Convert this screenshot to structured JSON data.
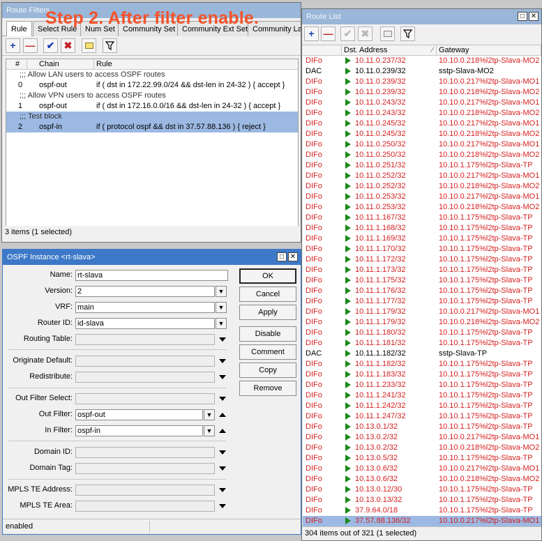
{
  "overlay_text": "Step 2. After filter enable.",
  "route_filters": {
    "title": "Route Filters",
    "tabs": [
      "Rule",
      "Select Rule",
      "Num Set",
      "Community Set",
      "Community Ext Set",
      "Community Lar"
    ],
    "columns": [
      "#",
      "Chain",
      "Rule"
    ],
    "rows": [
      {
        "type": "comment",
        "text": ";;; Allow LAN users to access OSPF routes"
      },
      {
        "type": "rule",
        "num": "0",
        "chain": "ospf-out",
        "rule": "if ( dst in 172.22.99.0/24 && dst-len in 24-32 ) { accept }"
      },
      {
        "type": "comment",
        "text": ";;; Allow VPN users to access OSPF routes"
      },
      {
        "type": "rule",
        "num": "1",
        "chain": "ospf-out",
        "rule": "if ( dst in 172.16.0.0/16 && dst-len in 24-32 ) { accept }"
      },
      {
        "type": "comment",
        "text": ";;; Test block",
        "selected": true
      },
      {
        "type": "rule",
        "num": "2",
        "chain": "ospf-in",
        "rule": "if ( protocol ospf && dst in 37.57.88.136 ) { reject }",
        "selected": true
      }
    ],
    "status": "3 items (1 selected)"
  },
  "ospf_instance": {
    "title": "OSPF Instance <rt-slava>",
    "fields": {
      "name_label": "Name:",
      "name": "rt-slava",
      "version_label": "Version:",
      "version": "2",
      "vrf_label": "VRF:",
      "vrf": "main",
      "router_id_label": "Router ID:",
      "router_id": "id-slava",
      "routing_table_label": "Routing Table:",
      "originate_default_label": "Originate Default:",
      "redistribute_label": "Redistribute:",
      "out_filter_select_label": "Out Filter Select:",
      "out_filter_label": "Out Filter:",
      "out_filter": "ospf-out",
      "in_filter_label": "In Filter:",
      "in_filter": "ospf-in",
      "domain_id_label": "Domain ID:",
      "domain_tag_label": "Domain Tag:",
      "mpls_te_address_label": "MPLS TE Address:",
      "mpls_te_area_label": "MPLS TE Area:"
    },
    "buttons": {
      "ok": "OK",
      "cancel": "Cancel",
      "apply": "Apply",
      "disable": "Disable",
      "comment": "Comment",
      "copy": "Copy",
      "remove": "Remove"
    },
    "status": "enabled"
  },
  "route_list": {
    "title": "Route List",
    "columns": [
      "Dst. Address",
      "Gateway"
    ],
    "rows": [
      {
        "flags": "DIFo",
        "dst": "10.11.0.237/32",
        "gw": "10.10.0.218%l2tp-Slava-MO2",
        "red": true
      },
      {
        "flags": "DAC",
        "dst": "10.11.0.239/32",
        "gw": "sstp-Slava-MO2",
        "red": false
      },
      {
        "flags": "DIFo",
        "dst": "10.11.0.239/32",
        "gw": "10.10.0.217%l2tp-Slava-MO1",
        "red": true
      },
      {
        "flags": "DIFo",
        "dst": "10.11.0.239/32",
        "gw": "10.10.0.218%l2tp-Slava-MO2",
        "red": true
      },
      {
        "flags": "DIFo",
        "dst": "10.11.0.243/32",
        "gw": "10.10.0.217%l2tp-Slava-MO1",
        "red": true
      },
      {
        "flags": "DIFo",
        "dst": "10.11.0.243/32",
        "gw": "10.10.0.218%l2tp-Slava-MO2",
        "red": true
      },
      {
        "flags": "DIFo",
        "dst": "10.11.0.245/32",
        "gw": "10.10.0.217%l2tp-Slava-MO1",
        "red": true
      },
      {
        "flags": "DIFo",
        "dst": "10.11.0.245/32",
        "gw": "10.10.0.218%l2tp-Slava-MO2",
        "red": true
      },
      {
        "flags": "DIFo",
        "dst": "10.11.0.250/32",
        "gw": "10.10.0.217%l2tp-Slava-MO1",
        "red": true
      },
      {
        "flags": "DIFo",
        "dst": "10.11.0.250/32",
        "gw": "10.10.0.218%l2tp-Slava-MO2",
        "red": true
      },
      {
        "flags": "DIFo",
        "dst": "10.11.0.251/32",
        "gw": "10.10.1.175%l2tp-Slava-TP",
        "red": true
      },
      {
        "flags": "DIFo",
        "dst": "10.11.0.252/32",
        "gw": "10.10.0.217%l2tp-Slava-MO1",
        "red": true
      },
      {
        "flags": "DIFo",
        "dst": "10.11.0.252/32",
        "gw": "10.10.0.218%l2tp-Slava-MO2",
        "red": true
      },
      {
        "flags": "DIFo",
        "dst": "10.11.0.253/32",
        "gw": "10.10.0.217%l2tp-Slava-MO1",
        "red": true
      },
      {
        "flags": "DIFo",
        "dst": "10.11.0.253/32",
        "gw": "10.10.0.218%l2tp-Slava-MO2",
        "red": true
      },
      {
        "flags": "DIFo",
        "dst": "10.11.1.167/32",
        "gw": "10.10.1.175%l2tp-Slava-TP",
        "red": true
      },
      {
        "flags": "DIFo",
        "dst": "10.11.1.168/32",
        "gw": "10.10.1.175%l2tp-Slava-TP",
        "red": true
      },
      {
        "flags": "DIFo",
        "dst": "10.11.1.169/32",
        "gw": "10.10.1.175%l2tp-Slava-TP",
        "red": true
      },
      {
        "flags": "DIFo",
        "dst": "10.11.1.170/32",
        "gw": "10.10.1.175%l2tp-Slava-TP",
        "red": true
      },
      {
        "flags": "DIFo",
        "dst": "10.11.1.172/32",
        "gw": "10.10.1.175%l2tp-Slava-TP",
        "red": true
      },
      {
        "flags": "DIFo",
        "dst": "10.11.1.173/32",
        "gw": "10.10.1.175%l2tp-Slava-TP",
        "red": true
      },
      {
        "flags": "DIFo",
        "dst": "10.11.1.175/32",
        "gw": "10.10.1.175%l2tp-Slava-TP",
        "red": true
      },
      {
        "flags": "DIFo",
        "dst": "10.11.1.176/32",
        "gw": "10.10.1.175%l2tp-Slava-TP",
        "red": true
      },
      {
        "flags": "DIFo",
        "dst": "10.11.1.177/32",
        "gw": "10.10.1.175%l2tp-Slava-TP",
        "red": true
      },
      {
        "flags": "DIFo",
        "dst": "10.11.1.179/32",
        "gw": "10.10.0.217%l2tp-Slava-MO1",
        "red": true
      },
      {
        "flags": "DIFo",
        "dst": "10.11.1.179/32",
        "gw": "10.10.0.218%l2tp-Slava-MO2",
        "red": true
      },
      {
        "flags": "DIFo",
        "dst": "10.11.1.180/32",
        "gw": "10.10.1.175%l2tp-Slava-TP",
        "red": true
      },
      {
        "flags": "DIFo",
        "dst": "10.11.1.181/32",
        "gw": "10.10.1.175%l2tp-Slava-TP",
        "red": true
      },
      {
        "flags": "DAC",
        "dst": "10.11.1.182/32",
        "gw": "sstp-Slava-TP",
        "red": false
      },
      {
        "flags": "DIFo",
        "dst": "10.11.1.182/32",
        "gw": "10.10.1.175%l2tp-Slava-TP",
        "red": true
      },
      {
        "flags": "DIFo",
        "dst": "10.11.1.183/32",
        "gw": "10.10.1.175%l2tp-Slava-TP",
        "red": true
      },
      {
        "flags": "DIFo",
        "dst": "10.11.1.233/32",
        "gw": "10.10.1.175%l2tp-Slava-TP",
        "red": true
      },
      {
        "flags": "DIFo",
        "dst": "10.11.1.241/32",
        "gw": "10.10.1.175%l2tp-Slava-TP",
        "red": true
      },
      {
        "flags": "DIFo",
        "dst": "10.11.1.242/32",
        "gw": "10.10.1.175%l2tp-Slava-TP",
        "red": true
      },
      {
        "flags": "DIFo",
        "dst": "10.11.1.247/32",
        "gw": "10.10.1.175%l2tp-Slava-TP",
        "red": true
      },
      {
        "flags": "DIFo",
        "dst": "10.13.0.1/32",
        "gw": "10.10.1.175%l2tp-Slava-TP",
        "red": true
      },
      {
        "flags": "DIFo",
        "dst": "10.13.0.2/32",
        "gw": "10.10.0.217%l2tp-Slava-MO1",
        "red": true
      },
      {
        "flags": "DIFo",
        "dst": "10.13.0.2/32",
        "gw": "10.10.0.218%l2tp-Slava-MO2",
        "red": true
      },
      {
        "flags": "DIFo",
        "dst": "10.13.0.5/32",
        "gw": "10.10.1.175%l2tp-Slava-TP",
        "red": true
      },
      {
        "flags": "DIFo",
        "dst": "10.13.0.6/32",
        "gw": "10.10.0.217%l2tp-Slava-MO1",
        "red": true
      },
      {
        "flags": "DIFo",
        "dst": "10.13.0.6/32",
        "gw": "10.10.0.218%l2tp-Slava-MO2",
        "red": true
      },
      {
        "flags": "DIFo",
        "dst": "10.13.0.12/30",
        "gw": "10.10.1.175%l2tp-Slava-TP",
        "red": true
      },
      {
        "flags": "DIFo",
        "dst": "10.13.0.13/32",
        "gw": "10.10.1.175%l2tp-Slava-TP",
        "red": true
      },
      {
        "flags": "DIFo",
        "dst": "37.9.64.0/18",
        "gw": "10.10.1.175%l2tp-Slava-TP",
        "red": true
      },
      {
        "flags": "DIFo",
        "dst": "37.57.88.136/32",
        "gw": "10.10.0.217%l2tp-Slava-MO1",
        "red": true,
        "selected": true
      }
    ],
    "status": "304 items out of 321 (1 selected)"
  },
  "colors": {
    "route_red": "#d62020",
    "selected_row": "#9cb9e3",
    "overlay": "#f5532a",
    "active_arrow": "#1a8a1a"
  },
  "icons": [
    "add-icon",
    "remove-icon",
    "enable-check-icon",
    "disable-x-icon",
    "comment-icon",
    "filter-icon",
    "sort-indicator-icon"
  ]
}
